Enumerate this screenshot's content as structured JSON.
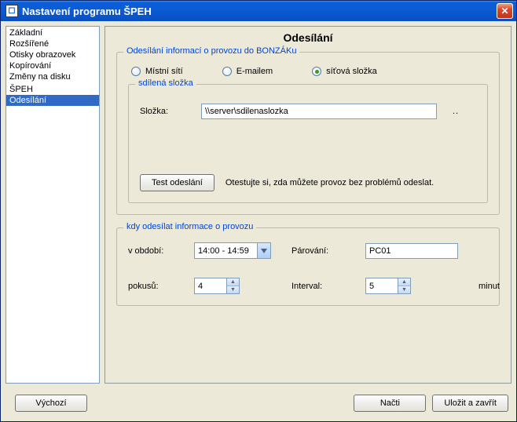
{
  "window": {
    "title": "Nastavení programu ŠPEH"
  },
  "sidebar": {
    "items": [
      {
        "label": "Základní"
      },
      {
        "label": "Rozšířené"
      },
      {
        "label": "Otisky obrazovek"
      },
      {
        "label": "Kopírování"
      },
      {
        "label": "Změny na disku"
      },
      {
        "label": ""
      },
      {
        "label": "ŠPEH"
      },
      {
        "label": "Odesílání",
        "selected": true
      }
    ]
  },
  "page": {
    "title": "Odesílání",
    "transport": {
      "legend": "Odesílání informací o provozu do BONZÁKu",
      "options": [
        {
          "label": "Místní sítí",
          "checked": false
        },
        {
          "label": "E-mailem",
          "checked": false
        },
        {
          "label": "síťová složka",
          "checked": true
        }
      ],
      "share": {
        "legend": "sdílená složka",
        "folder_label": "Složka:",
        "folder_value": "\\\\server\\sdilenaslozka",
        "browse_dots": "..",
        "test_label": "Test odeslání",
        "test_hint": "Otestujte si, zda můžete provoz bez problémů odeslat."
      }
    },
    "schedule": {
      "legend": "kdy odesílat informace o provozu",
      "period_label": "v období:",
      "period_value": "14:00 - 14:59",
      "pair_label": "Párování:",
      "pair_value": "PC01",
      "tries_label": "pokusů:",
      "tries_value": "4",
      "interval_label": "Interval:",
      "interval_value": "5",
      "interval_unit": "minut"
    }
  },
  "footer": {
    "default_label": "Výchozí",
    "load_label": "Načti",
    "save_label": "Uložit a zavřít"
  }
}
